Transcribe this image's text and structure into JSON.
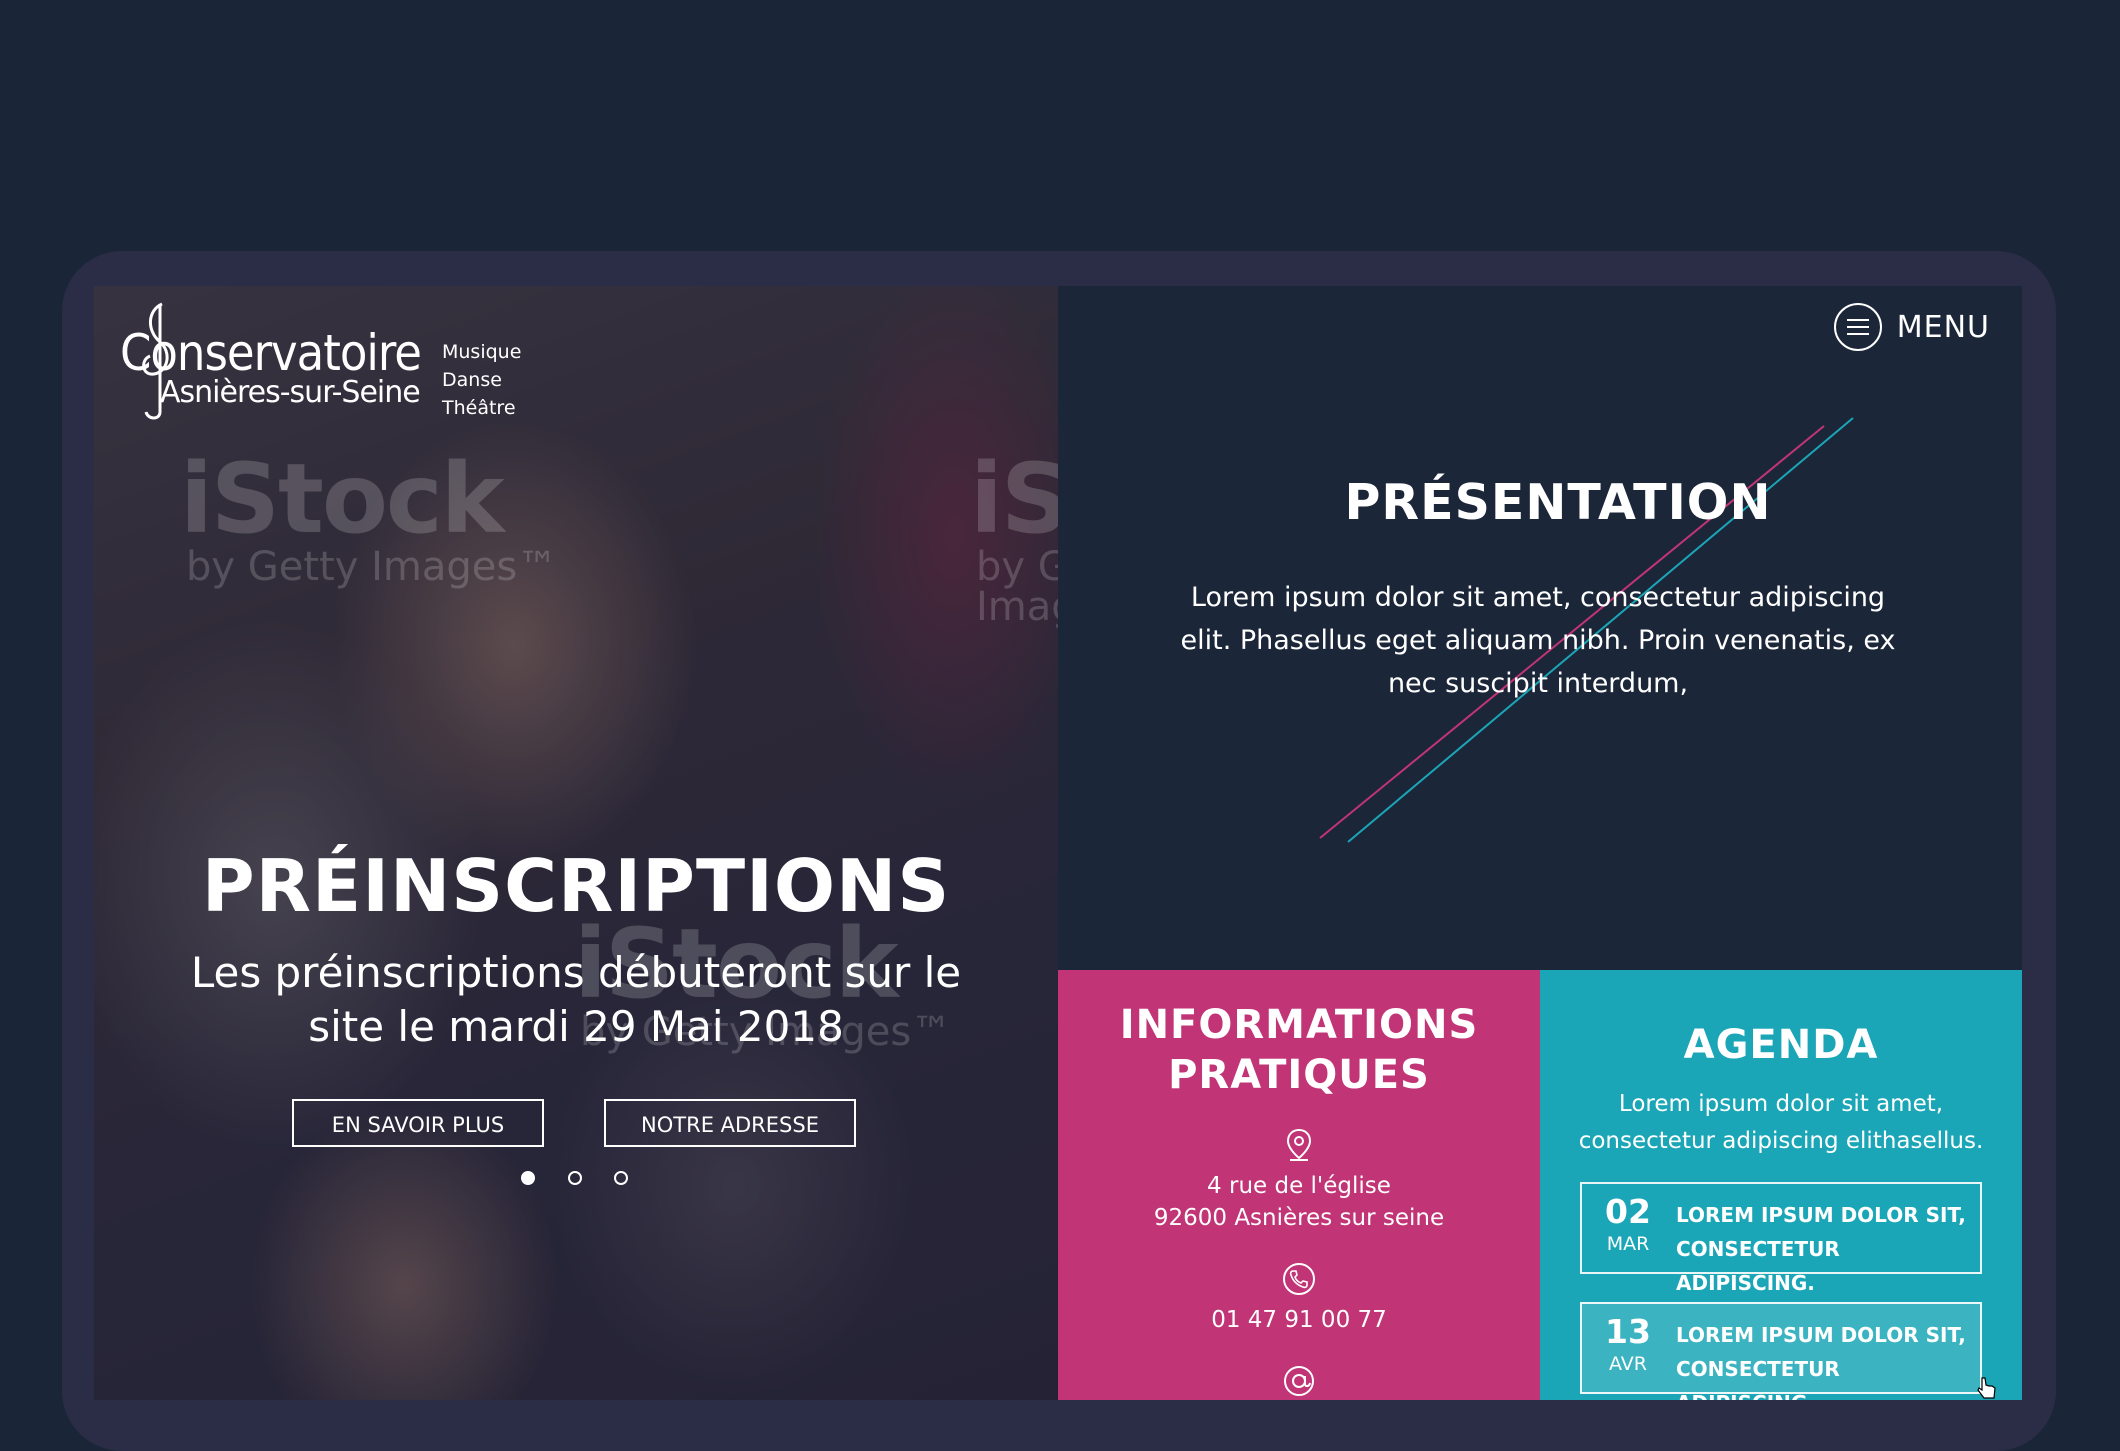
{
  "brand": {
    "name_line1": "Conservatoire",
    "name_line2": "Asnières-sur-Seine",
    "tag1": "Musique",
    "tag2": "Danse",
    "tag3": "Théâtre"
  },
  "watermarks": {
    "brand": "iStock",
    "byline": "by Getty Images™"
  },
  "menu": {
    "label": "MENU",
    "icon": "hamburger-circle-icon"
  },
  "hero": {
    "title": "PRÉINSCRIPTIONS",
    "text": "Les préinscriptions débuteront sur le site le mardi 29 Mai 2018",
    "button1": "EN SAVOIR PLUS",
    "button2": "NOTRE ADRESSE",
    "slides_total": 3,
    "slide_active": 1
  },
  "presentation": {
    "title": "PRÉSENTATION",
    "text": "Lorem ipsum dolor sit amet, consectetur adipiscing elit. Phasellus eget aliquam nibh. Proin venenatis, ex nec suscipit interdum,"
  },
  "info": {
    "title": "INFORMATIONS PRATIQUES",
    "address_line1": "4 rue de l'église",
    "address_line2": "92600 Asnières sur seine",
    "phone": "01 47 91 00 77",
    "icons": [
      "location-pin-icon",
      "phone-icon",
      "at-sign-icon"
    ]
  },
  "agenda": {
    "title": "AGENDA",
    "text": "Lorem ipsum dolor sit amet, consectetur adipiscing elithasellus.",
    "events": [
      {
        "day": "02",
        "month": "MAR",
        "text": "LOREM IPSUM DOLOR SIT, CONSECTETUR ADIPISCING."
      },
      {
        "day": "13",
        "month": "AVR",
        "text": "LOREM IPSUM DOLOR SIT, CONSECTETUR ADIPISCING."
      }
    ]
  },
  "colors": {
    "background": "#1b2538",
    "device_frame": "#2a2d45",
    "info_panel": "#c13475",
    "agenda_panel": "#1ba6b7",
    "accent_line_pink": "#c13475",
    "accent_line_cyan": "#1ba6b7"
  }
}
